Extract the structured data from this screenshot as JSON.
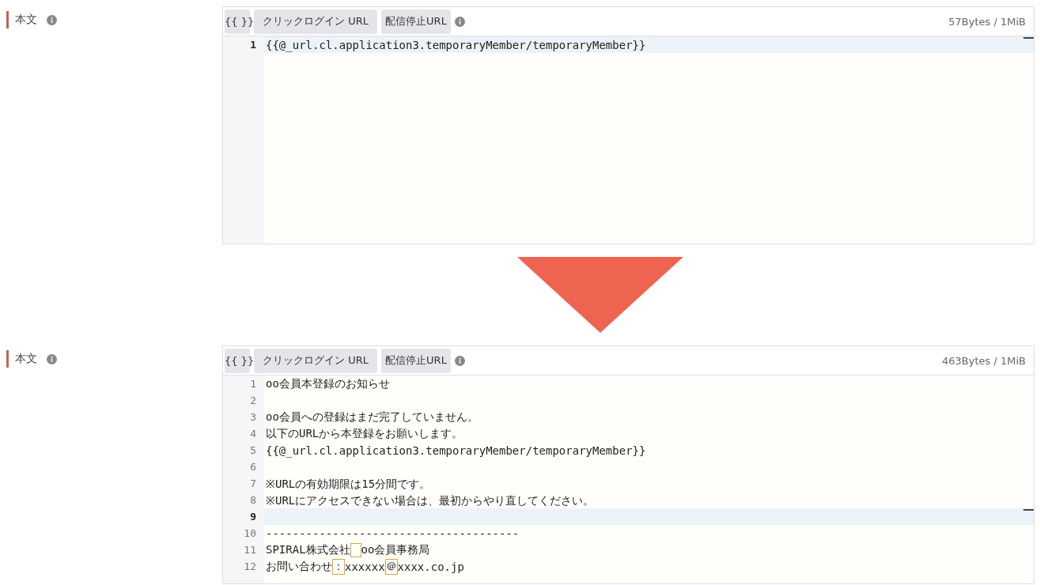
{
  "editors": [
    {
      "label": "本文",
      "toolbar": [
        {
          "label": "{{ }}",
          "kind": "small"
        },
        {
          "label": "クリックログイン URL",
          "kind": "wide"
        },
        {
          "label": "配信停止URL",
          "kind": "normal"
        }
      ],
      "byte_count": "57Bytes / 1MiB",
      "lines": [
        {
          "number": "1",
          "active": true,
          "segments": [
            {
              "text": "{{@_url.cl.application3.temporaryMember/temporaryMember}}",
              "kind": "text"
            }
          ]
        }
      ]
    },
    {
      "label": "本文",
      "toolbar": [
        {
          "label": "{{ }}",
          "kind": "small"
        },
        {
          "label": "クリックログイン URL",
          "kind": "wide"
        },
        {
          "label": "配信停止URL",
          "kind": "normal"
        }
      ],
      "byte_count": "463Bytes / 1MiB",
      "lines": [
        {
          "number": "1",
          "active": false,
          "segments": [
            {
              "text": "oo会員本登録のお知らせ",
              "kind": "text"
            }
          ]
        },
        {
          "number": "2",
          "active": false
        },
        {
          "number": "3",
          "active": false,
          "segments": [
            {
              "text": "oo会員への登録はまだ完了していません。",
              "kind": "text"
            }
          ]
        },
        {
          "number": "4",
          "active": false,
          "segments": [
            {
              "text": "以下のURLから本登録をお願いします。",
              "kind": "text"
            }
          ]
        },
        {
          "number": "5",
          "active": false,
          "segments": [
            {
              "text": "{{@_url.cl.application3.temporaryMember/temporaryMember}}",
              "kind": "text"
            }
          ]
        },
        {
          "number": "6",
          "active": false
        },
        {
          "number": "7",
          "active": false,
          "segments": [
            {
              "text": "※URLの有効期限は15分間です。",
              "kind": "text"
            }
          ]
        },
        {
          "number": "8",
          "active": false,
          "segments": [
            {
              "text": "※URLにアクセスできない場合は、最初からやり直してください。",
              "kind": "text"
            }
          ]
        },
        {
          "number": "9",
          "active": true
        },
        {
          "number": "10",
          "active": false,
          "segments": [
            {
              "text": "--------------------------------------",
              "kind": "text"
            }
          ]
        },
        {
          "number": "11",
          "active": false,
          "segments": [
            {
              "text": "SPIRAL株式会社",
              "kind": "text"
            },
            {
              "kind": "fullwidth-space"
            },
            {
              "text": "oo会員事務局",
              "kind": "text"
            }
          ]
        },
        {
          "number": "12",
          "active": false,
          "segments": [
            {
              "text": "お問い合わせ",
              "kind": "text"
            },
            {
              "text": "：",
              "kind": "fullwidth"
            },
            {
              "text": "xxxxxx",
              "kind": "text"
            },
            {
              "text": "＠",
              "kind": "fullwidth"
            },
            {
              "text": "xxxx.co.jp",
              "kind": "text"
            }
          ]
        }
      ]
    }
  ]
}
